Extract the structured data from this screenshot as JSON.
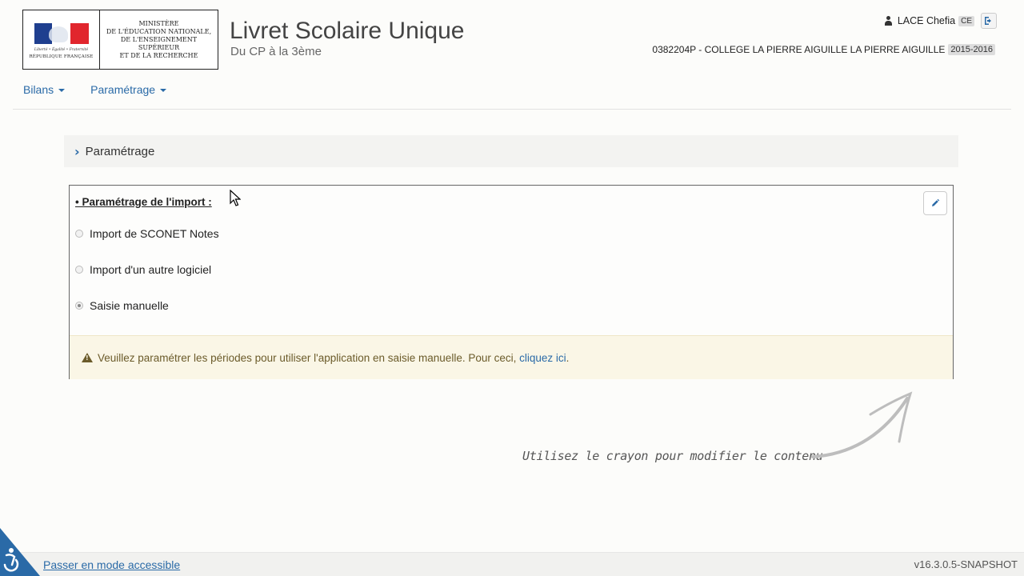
{
  "header": {
    "ministere_lines": "MINISTÈRE\nDE L'ÉDUCATION NATIONALE,\nDE L'ENSEIGNEMENT SUPÉRIEUR\nET DE LA RECHERCHE",
    "devise": "Liberté • Égalité • Fraternité",
    "republique": "RÉPUBLIQUE FRANÇAISE",
    "app_title": "Livret Scolaire Unique",
    "app_subtitle": "Du CP à la 3ème",
    "user_name": "LACE Chefia",
    "user_role": "CE",
    "school": "0382204P - COLLEGE LA PIERRE AIGUILLE LA PIERRE AIGUILLE",
    "year": "2015-2016"
  },
  "nav": {
    "items": [
      {
        "label": "Bilans"
      },
      {
        "label": "Paramétrage"
      }
    ]
  },
  "section": {
    "title": "Paramétrage"
  },
  "panel": {
    "heading": "• Paramétrage de l'import :",
    "options": [
      {
        "label": "Import de SCONET Notes",
        "checked": false
      },
      {
        "label": "Import d'un autre logiciel",
        "checked": false
      },
      {
        "label": "Saisie manuelle",
        "checked": true
      }
    ],
    "alert_text": "Veuillez paramétrer les périodes pour utiliser l'application en saisie manuelle. Pour ceci,",
    "alert_link": "cliquez ici",
    "alert_end": "."
  },
  "hint": {
    "text": "Utilisez le crayon pour modifier le contenu"
  },
  "footer": {
    "accessible_link": "Passer en mode accessible",
    "version": "v16.3.0.5-SNAPSHOT"
  },
  "colors": {
    "link": "#2a6aa7",
    "alert_bg": "#faf6e6"
  }
}
